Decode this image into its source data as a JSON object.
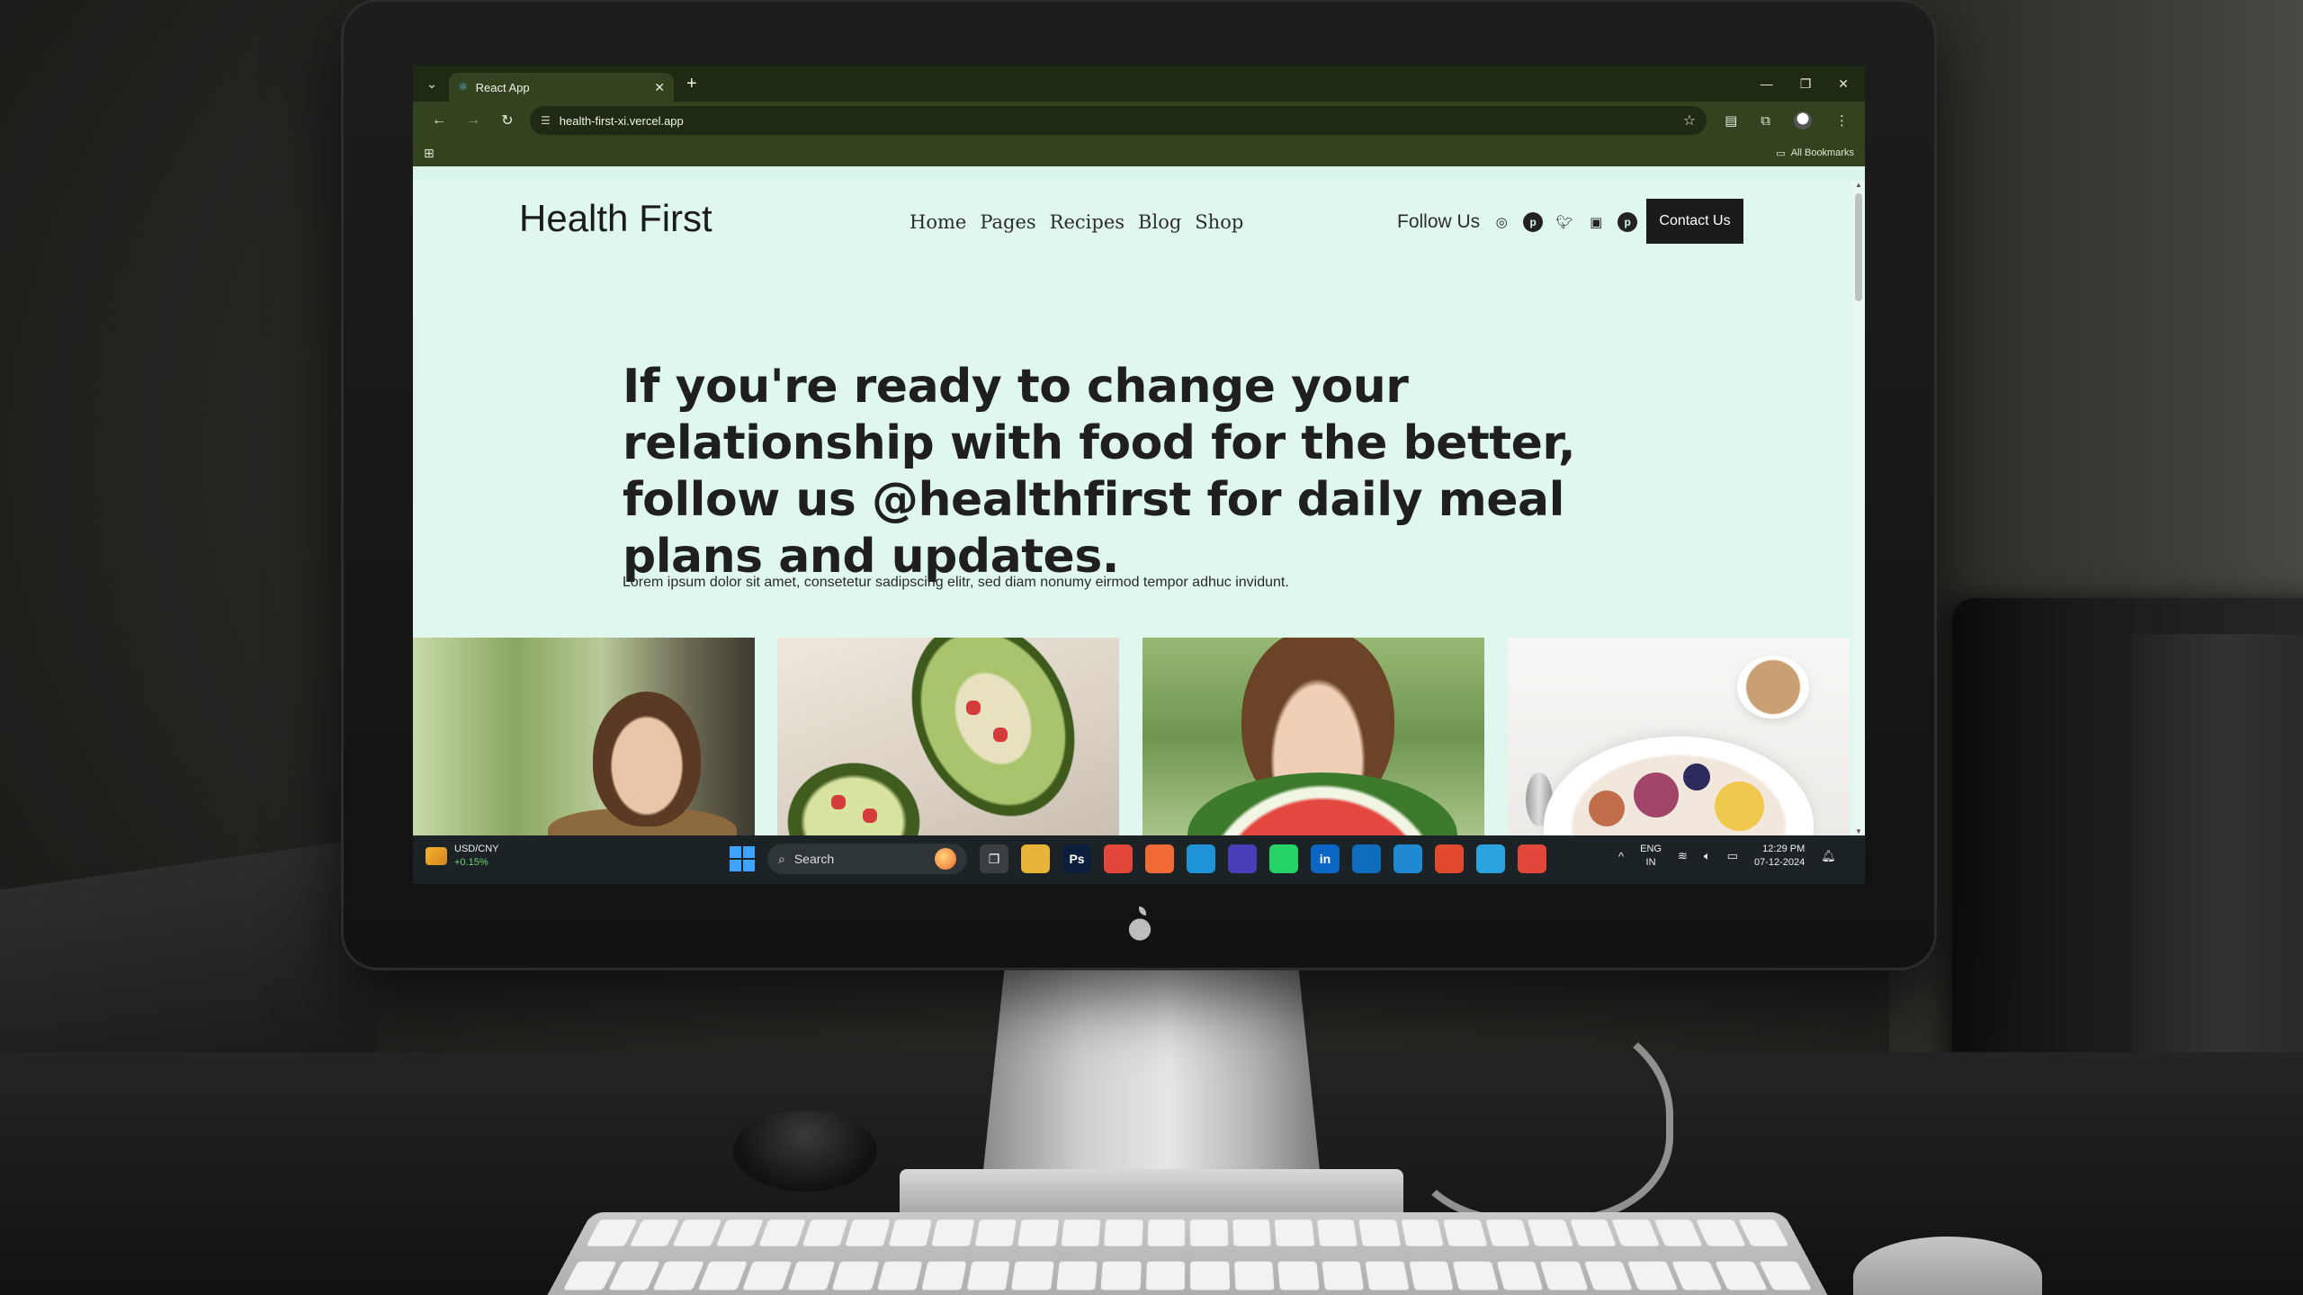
{
  "browser": {
    "tab_title": "React App",
    "tab_favicon": "react-icon",
    "new_tab_symbol": "+",
    "url": "health-first-xi.vercel.app",
    "bookmarks_label": "All Bookmarks"
  },
  "site": {
    "brand": "Health First",
    "nav": [
      "Home",
      "Pages",
      "Recipes",
      "Blog",
      "Shop"
    ],
    "follow_label": "Follow Us",
    "social_icons": [
      "instagram-icon",
      "pinterest-icon",
      "twitter-icon",
      "shopping-bag-icon",
      "pinterest-icon"
    ],
    "contact_button": "Contact Us",
    "hero_before": "If you're ready to change your relationship with food for the better, follow us ",
    "hero_handle": "@healthfirst",
    "hero_after": " for daily meal plans and updates.",
    "lede": "Lorem ipsum dolor sit amet, consetetur sadipscing elitr, sed diam nonumy eirmod tempor adhuc invidunt.",
    "gallery": [
      "smiling-woman-photo",
      "stuffed-avocado-photo",
      "woman-with-watermelon-photo",
      "fruit-bowl-breakfast-photo"
    ]
  },
  "taskbar": {
    "ticker_name": "USD/CNY",
    "ticker_change": "+0.15%",
    "search_placeholder": "Search",
    "apps": [
      {
        "name": "file-explorer",
        "color": "#e8b53a"
      },
      {
        "name": "photoshop",
        "glyph": "Ps",
        "color": "#0b1e3b"
      },
      {
        "name": "chrome",
        "color": "#e3463a"
      },
      {
        "name": "postman",
        "color": "#f06a35"
      },
      {
        "name": "edge",
        "color": "#1e93d6"
      },
      {
        "name": "app",
        "color": "#4a3fb8"
      },
      {
        "name": "whatsapp",
        "color": "#25d366"
      },
      {
        "name": "linkedin",
        "glyph": "in",
        "color": "#0a66c2"
      },
      {
        "name": "outlook",
        "color": "#0f6cbd"
      },
      {
        "name": "vscode",
        "color": "#1f8ad2"
      },
      {
        "name": "maps",
        "color": "#e24a2f"
      },
      {
        "name": "telegram",
        "color": "#2aa3df"
      },
      {
        "name": "chrome-active",
        "color": "#e3463a"
      }
    ],
    "lang_top": "ENG",
    "lang_bottom": "IN",
    "time": "12:29 PM",
    "date": "07-12-2024"
  }
}
